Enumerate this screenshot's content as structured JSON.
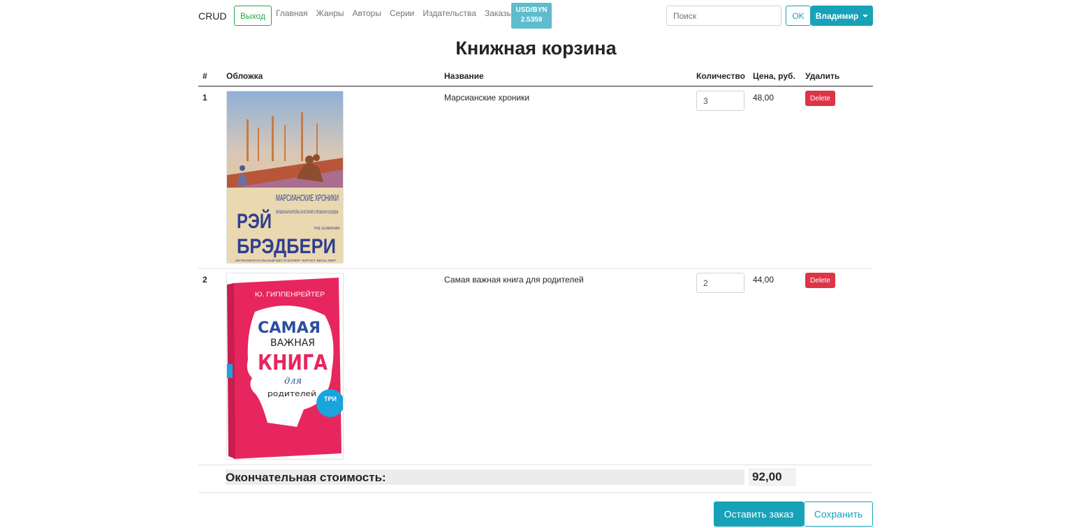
{
  "navbar": {
    "brand": "CRUD",
    "logout_label": "Выход",
    "links": [
      "Главная",
      "Жанры",
      "Авторы",
      "Серии",
      "Издательства",
      "Заказы"
    ],
    "rate_label": "USD/BYN",
    "rate_value": "2.5359",
    "search_placeholder": "Поиск",
    "search_button": "OK",
    "user_name": "Владимир"
  },
  "page": {
    "title": "Книжная корзина"
  },
  "table": {
    "headers": {
      "num": "#",
      "cover": "Обложка",
      "name": "Название",
      "qty": "Количество",
      "price": "Цена, руб.",
      "delete": "Удалить"
    },
    "rows": [
      {
        "num": "1",
        "name": "Марсианские хроники",
        "qty": "3",
        "price": "48,00",
        "delete_label": "Delete",
        "cover": {
          "title": "МАРСИАНСКИЕ ХРОНИКИ",
          "subtitle": "ВОЛШЕБНЫЙ КОКТЕЙЛЬ ИЗ ИСТОРИЙ О ПРОШЛОМ И БУДУЩЕМ.",
          "quote_source": "THE GUARDIAN",
          "author_first": "РЭЙ",
          "author_last": "БРЭДБЕРИ",
          "footer": "ИНТЕЛЛЕКТУАЛЬНЫЙ БЕСТСЕЛЛЕР ЧИТАЕТ ВЕСЬ МИР"
        }
      },
      {
        "num": "2",
        "name": "Самая важная книга для родителей",
        "qty": "2",
        "price": "44,00",
        "delete_label": "Delete",
        "cover": {
          "author": "Ю. ГИППЕНРЕЙТЕР",
          "title_1": "САМАЯ",
          "title_2": "ВАЖНАЯ",
          "title_3": "КНИГА",
          "title_4": "для",
          "title_5": "родителей",
          "badge": "ТРИ"
        }
      }
    ]
  },
  "total": {
    "label": "Окончательная стоимость:",
    "value": "92,00"
  },
  "actions": {
    "order_label": "Оставить заказ",
    "save_label": "Сохранить"
  },
  "colors": {
    "primary": "#17a2b8",
    "success": "#28a745",
    "danger": "#dc3545",
    "rate_badge": "#5fbccd",
    "cover2_pink": "#e8265e"
  }
}
